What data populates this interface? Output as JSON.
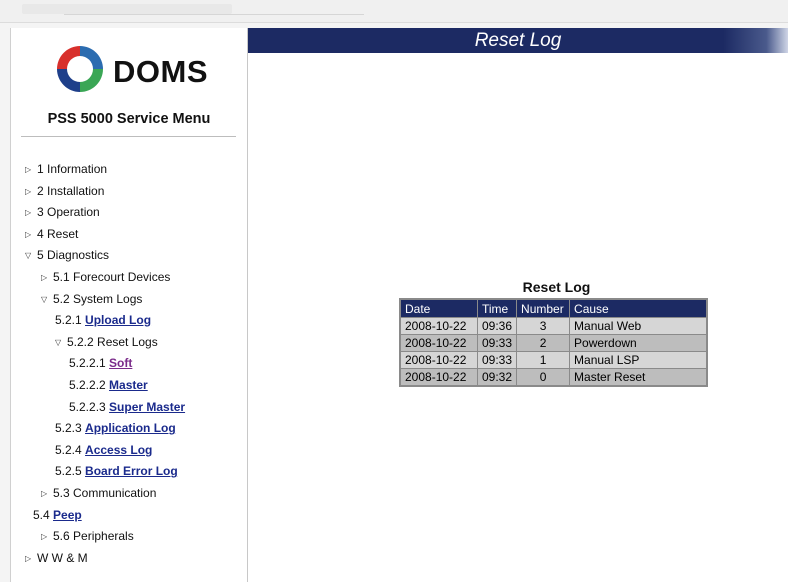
{
  "logo": {
    "brand": "DOMS",
    "icon": "doms-logo-icon"
  },
  "sidebar": {
    "title": "PSS 5000 Service Menu",
    "items": [
      {
        "prefix": "1 Information",
        "link": "",
        "expander": "collapsed"
      },
      {
        "prefix": "2 Installation",
        "link": "",
        "expander": "collapsed"
      },
      {
        "prefix": "3 Operation",
        "link": "",
        "expander": "collapsed"
      },
      {
        "prefix": "4 Reset",
        "link": "",
        "expander": "collapsed"
      },
      {
        "prefix": "5 Diagnostics",
        "link": "",
        "expander": "expanded"
      },
      {
        "prefix": "5.1 Forecourt Devices",
        "link": "",
        "expander": "collapsed"
      },
      {
        "prefix": "5.2 System Logs",
        "link": "",
        "expander": "expanded"
      },
      {
        "prefix": "5.2.1 ",
        "link": "Upload Log",
        "expander": "none"
      },
      {
        "prefix": "5.2.2 Reset Logs",
        "link": "",
        "expander": "expanded"
      },
      {
        "prefix": "5.2.2.1 ",
        "link": "Soft",
        "expander": "none",
        "visited": true
      },
      {
        "prefix": "5.2.2.2 ",
        "link": "Master",
        "expander": "none"
      },
      {
        "prefix": "5.2.2.3 ",
        "link": "Super Master",
        "expander": "none"
      },
      {
        "prefix": "5.2.3 ",
        "link": "Application Log",
        "expander": "none"
      },
      {
        "prefix": "5.2.4 ",
        "link": "Access Log",
        "expander": "none"
      },
      {
        "prefix": "5.2.5 ",
        "link": "Board Error Log",
        "expander": "none"
      },
      {
        "prefix": "5.3 Communication",
        "link": "",
        "expander": "collapsed"
      },
      {
        "prefix": "5.4 ",
        "link": "Peep",
        "expander": "none"
      },
      {
        "prefix": "5.6 Peripherals",
        "link": "",
        "expander": "collapsed"
      },
      {
        "prefix": "W W & M",
        "link": "",
        "expander": "collapsed"
      }
    ]
  },
  "banner": {
    "title": "Reset Log"
  },
  "reset_log": {
    "caption": "Reset Log",
    "columns": [
      "Date",
      "Time",
      "Number",
      "Cause"
    ],
    "rows": [
      [
        "2008-10-22",
        "09:36",
        "3",
        "Manual Web"
      ],
      [
        "2008-10-22",
        "09:33",
        "2",
        "Powerdown"
      ],
      [
        "2008-10-22",
        "09:33",
        "1",
        "Manual LSP"
      ],
      [
        "2008-10-22",
        "09:32",
        "0",
        "Master Reset"
      ]
    ]
  },
  "colors": {
    "banner": "#1c2a63",
    "link": "#1a2a8c",
    "link_visited": "#7a2a8a",
    "row_light": "#d6d6d6",
    "row_dark": "#bdbdbd"
  }
}
